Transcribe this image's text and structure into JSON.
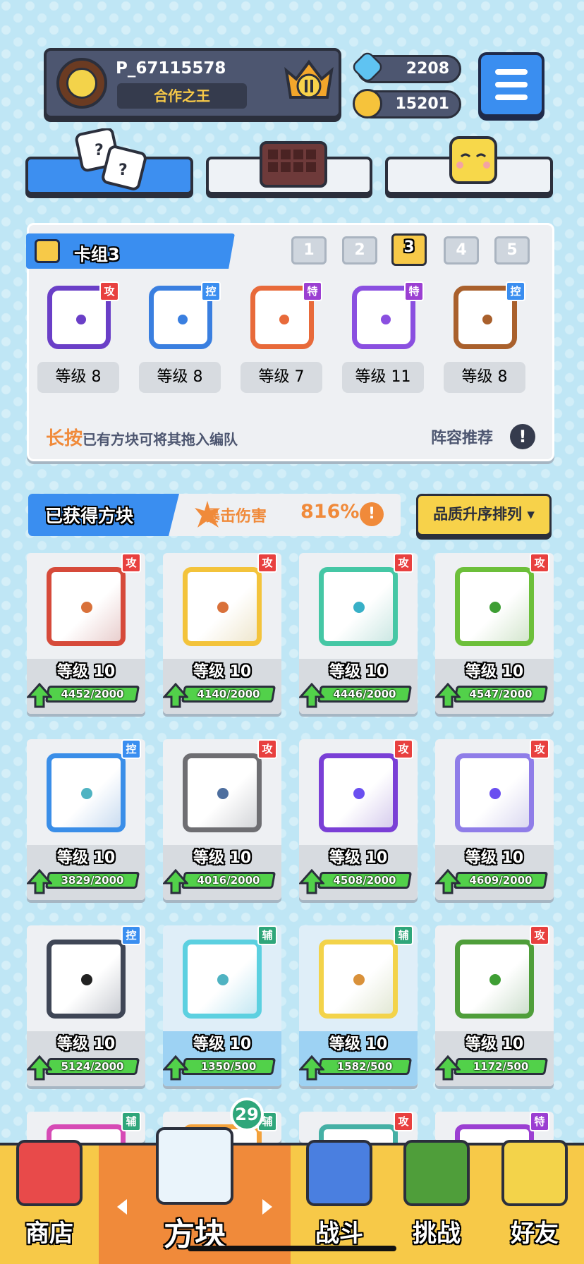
{
  "profile": {
    "username": "P_67115578",
    "title": "合作之王",
    "rank_icon": "crown-shield-rank-II"
  },
  "currency": {
    "gems": "2208",
    "coins": "15201"
  },
  "deck": {
    "name": "卡组3",
    "slots": [
      "1",
      "2",
      "3",
      "4",
      "5"
    ],
    "active_slot": "3",
    "cards": [
      {
        "type": "攻",
        "level": "等级 8",
        "color": "#6a3fc7"
      },
      {
        "type": "控",
        "level": "等级 8",
        "color": "#3a7fe0"
      },
      {
        "type": "特",
        "level": "等级 7",
        "color": "#e86a3a"
      },
      {
        "type": "特",
        "level": "等级 11",
        "color": "#8a4fe0"
      },
      {
        "type": "控",
        "level": "等级 8",
        "color": "#a9602c"
      }
    ],
    "hint_highlight": "长按",
    "hint_text": "已有方块可将其拖入编队",
    "recommend": "阵容推荐"
  },
  "owned": {
    "title": "已获得方块",
    "crit_label": "暴击伤害",
    "crit_value": "816%",
    "sort_label": "品质升序排列 ▾",
    "cards": [
      {
        "type": "攻",
        "level": "等级 10",
        "progress": "4452/2000",
        "color": "#d64a3a",
        "dot": "#d9713a"
      },
      {
        "type": "攻",
        "level": "等级 10",
        "progress": "4140/2000",
        "color": "#f3c33b",
        "dot": "#d9713a"
      },
      {
        "type": "攻",
        "level": "等级 10",
        "progress": "4446/2000",
        "color": "#45c7a5",
        "dot": "#38b0c7"
      },
      {
        "type": "攻",
        "level": "等级 10",
        "progress": "4547/2000",
        "color": "#6cbf3a",
        "dot": "#3e9e34"
      },
      {
        "type": "控",
        "level": "等级 10",
        "progress": "3829/2000",
        "color": "#3a8ee8",
        "dot": "#4fb3c2"
      },
      {
        "type": "攻",
        "level": "等级 10",
        "progress": "4016/2000",
        "color": "#6e6e72",
        "dot": "#4d6e9e"
      },
      {
        "type": "攻",
        "level": "等级 10",
        "progress": "4508/2000",
        "color": "#7a3fd6",
        "dot": "#6a4ff0"
      },
      {
        "type": "攻",
        "level": "等级 10",
        "progress": "4609/2000",
        "color": "#8f7de8",
        "dot": "#6a4ff0"
      },
      {
        "type": "控",
        "level": "等级 10",
        "progress": "5124/2000",
        "color": "#3f4656",
        "dot": "#222222"
      },
      {
        "type": "辅",
        "level": "等级 10",
        "progress": "1350/500",
        "color": "#5cd0e0",
        "dot": "#4fb3c2"
      },
      {
        "type": "辅",
        "level": "等级 10",
        "progress": "1582/500",
        "color": "#f3d34a",
        "dot": "#d9913a"
      },
      {
        "type": "攻",
        "level": "等级 10",
        "progress": "1172/500",
        "color": "#4f9e3a",
        "dot": "#3e9e34"
      }
    ],
    "partial_row": [
      {
        "type": "辅",
        "color": "#d64ab5"
      },
      {
        "type": "辅",
        "color": "#f3a13b"
      },
      {
        "type": "攻",
        "color": "#45b0a5"
      },
      {
        "type": "特",
        "color": "#9b3fd2"
      }
    ]
  },
  "nav": {
    "shop": "商店",
    "blocks": "方块",
    "blocks_badge": "29",
    "battle": "战斗",
    "challenge": "挑战",
    "friends": "好友"
  }
}
